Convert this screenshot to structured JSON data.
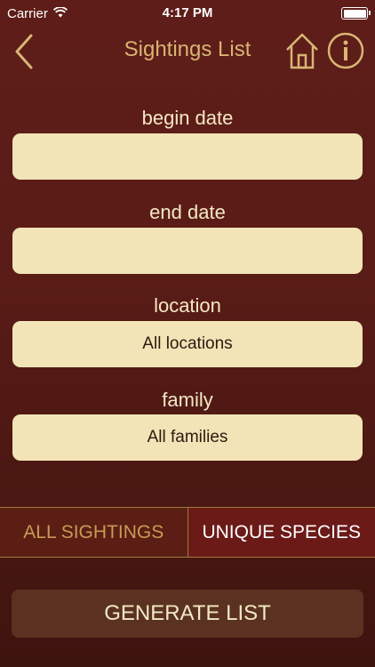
{
  "status_bar": {
    "carrier": "Carrier",
    "time": "4:17 PM"
  },
  "nav": {
    "title": "Sightings List",
    "back_icon": "chevron-left-icon",
    "home_icon": "home-icon",
    "info_icon": "info-icon"
  },
  "form": {
    "begin_date": {
      "label": "begin date",
      "value": ""
    },
    "end_date": {
      "label": "end date",
      "value": ""
    },
    "location": {
      "label": "location",
      "value": "All locations"
    },
    "family": {
      "label": "family",
      "value": "All families"
    }
  },
  "segmented": {
    "all_sightings": "ALL SIGHTINGS",
    "unique_species": "UNIQUE SPECIES",
    "selected": "unique_species"
  },
  "generate_label": "GENERATE LIST",
  "colors": {
    "accent_gold": "#d8b574",
    "field_fill": "#f2e4b6",
    "background": "#5e1d18"
  }
}
